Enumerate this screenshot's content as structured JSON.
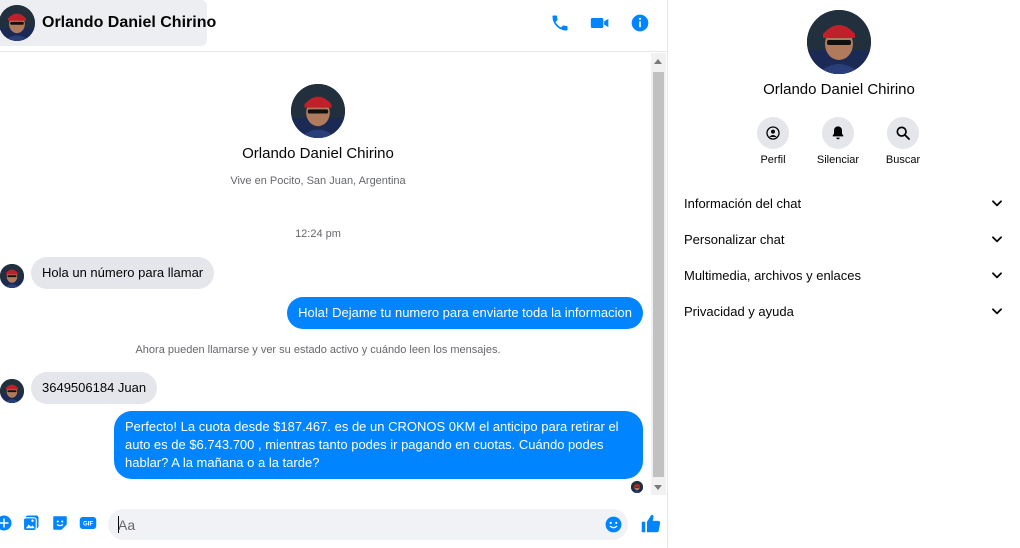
{
  "header": {
    "contact_name": "Orlando Daniel Chirino"
  },
  "intro": {
    "name": "Orlando Daniel Chirino",
    "location": "Vive en Pocito, San Juan, Argentina"
  },
  "conversation": {
    "timestamp": "12:24 pm",
    "notice": "Ahora pueden llamarse y ver su estado activo y cuándo leen los mensajes.",
    "messages": [
      {
        "direction": "in",
        "text": "Hola un número para llamar"
      },
      {
        "direction": "out",
        "text": "Hola! Dejame tu numero  para enviarte toda la informacion"
      },
      {
        "direction": "in",
        "text": "3649506184 Juan"
      },
      {
        "direction": "out",
        "text": "Perfecto! La cuota desde $187.467. es de un CRONOS 0KM el anticipo para retirar el auto es de $6.743.700 , mientras tanto podes ir pagando en cuotas. Cuándo podes hablar? A la mañana o a la tarde?"
      }
    ]
  },
  "composer": {
    "placeholder": "Aa"
  },
  "info_panel": {
    "name": "Orlando Daniel Chirino",
    "actions": [
      {
        "label": "Perfil",
        "icon": "profile-icon"
      },
      {
        "label": "Silenciar",
        "icon": "bell-icon"
      },
      {
        "label": "Buscar",
        "icon": "search-icon"
      }
    ],
    "sections": [
      {
        "label": "Información del chat"
      },
      {
        "label": "Personalizar chat"
      },
      {
        "label": "Multimedia, archivos y enlaces"
      },
      {
        "label": "Privacidad y ayuda"
      }
    ]
  },
  "colors": {
    "accent": "#0084ff",
    "incoming_bubble": "#e4e6eb",
    "secondary_text": "#65676b"
  }
}
